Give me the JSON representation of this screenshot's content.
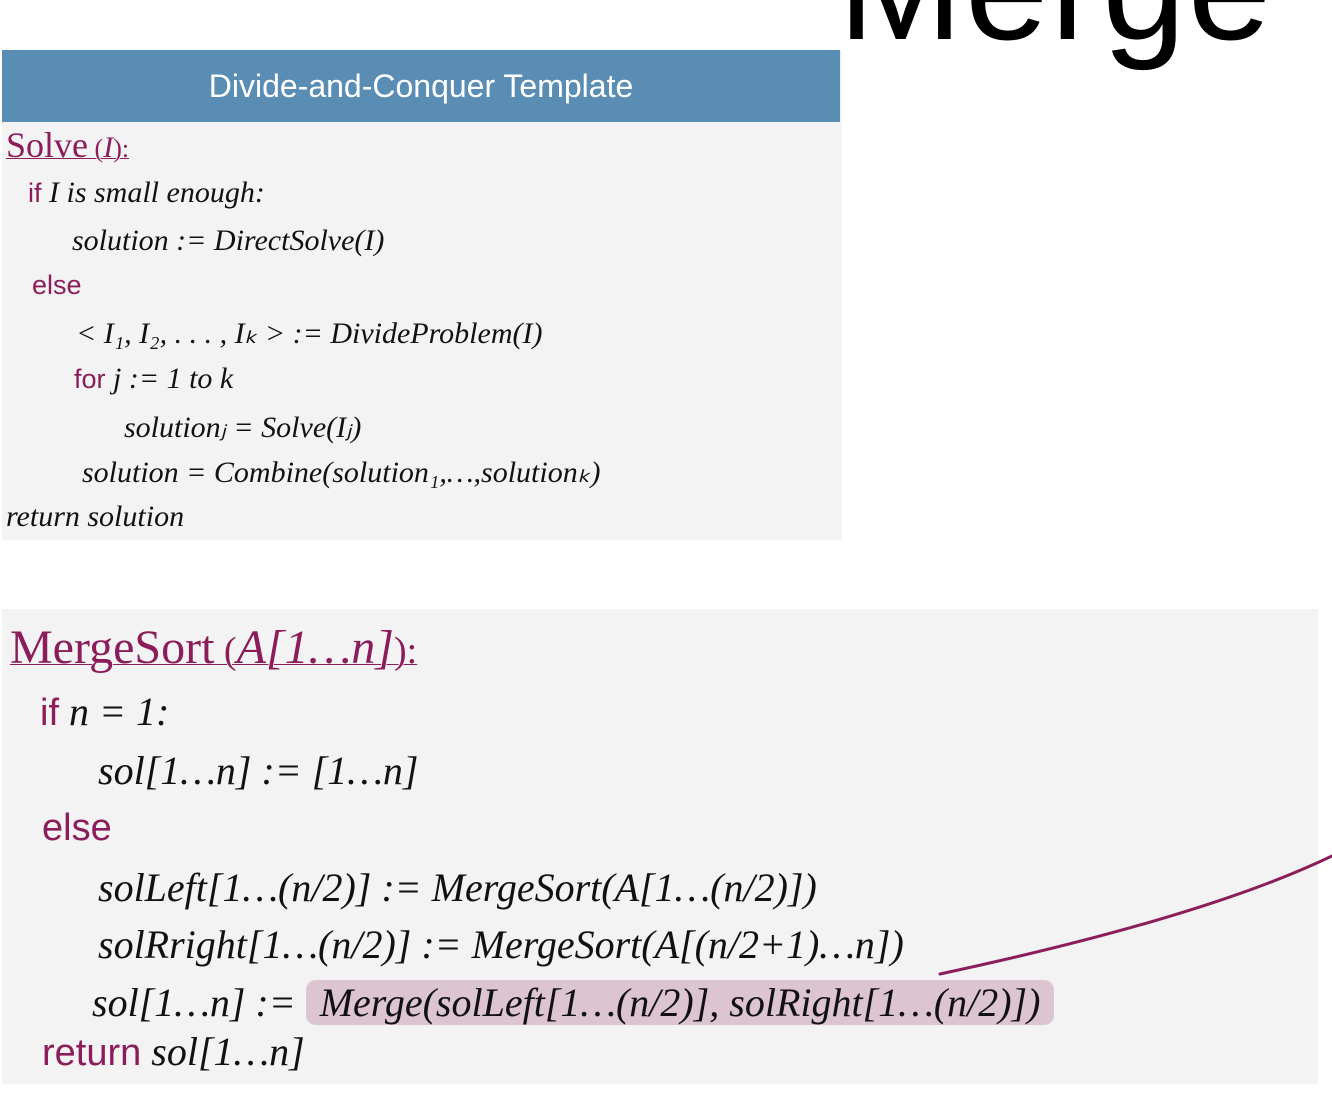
{
  "slide": {
    "title_fragment": "Merge"
  },
  "template_panel": {
    "header": "Divide-and-Conquer Template",
    "func_name": "Solve",
    "func_open": " (",
    "func_param": "I",
    "func_close": "):",
    "kw_if": "if",
    "kw_else": "else",
    "kw_for": "for",
    "cond_text": "I is small enough:",
    "line_direct": "solution  :=  DirectSolve(I)",
    "line_divide": "< I₁, I₂, . . . , Iₖ >  := DivideProblem(I)",
    "for_text": "j := 1 to k",
    "line_solve": "solutionⱼ = Solve(Iⱼ)",
    "line_combine": "solution = Combine(solution₁,…,solutionₖ)",
    "line_return": "return solution"
  },
  "mergesort_panel": {
    "func_name": "MergeSort",
    "func_param": "A[1…n]",
    "func_open": " (",
    "func_close": "):",
    "kw_if": "if",
    "kw_else": "else",
    "kw_return": "return",
    "cond_text": "n = 1:",
    "line_base": "sol[1…n]  :=  [1…n]",
    "line_left": "solLeft[1…(n/2)] := MergeSort(A[1…(n/2)])",
    "line_right": "solRright[1…(n/2)] := MergeSort(A[(n/2+1)…n])",
    "line_merge_lhs": "sol[1…n] :=",
    "line_merge_rhs": "Merge(solLeft[1…(n/2)], solRight[1…(n/2)])",
    "return_text": "sol[1…n]"
  },
  "colors": {
    "header_bg": "#5a8db4",
    "keyword": "#8a1d5a",
    "highlight": "#dcc4d0",
    "panel_bg": "#f3f3f3",
    "annotation_line": "#8a1d5a"
  }
}
